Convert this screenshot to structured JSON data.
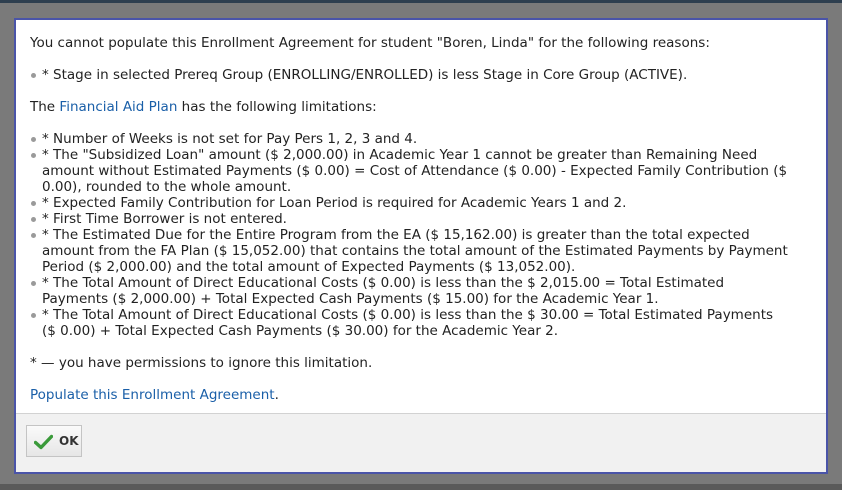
{
  "dialog": {
    "intro": "You cannot populate this Enrollment Agreement for student \"Boren, Linda\" for the following reasons:",
    "reasons": [
      "* Stage in selected Prereq Group (ENROLLING/ENROLLED) is less Stage in Core Group (ACTIVE)."
    ],
    "fa_prefix": "The ",
    "fa_link": "Financial Aid Plan",
    "fa_suffix": " has the following limitations:",
    "limitations": [
      [
        "* Number of Weeks is not set for Pay Pers 1, 2, 3 and 4."
      ],
      [
        "* The \"Subsidized Loan\" amount ($ 2,000.00) in Academic Year 1 cannot be greater than Remaining Need",
        "amount without Estimated Payments ($ 0.00) = Cost of Attendance ($ 0.00) - Expected Family Contribution ($",
        "0.00), rounded to the whole amount."
      ],
      [
        "* Expected Family Contribution for Loan Period is required for Academic Years 1 and 2."
      ],
      [
        "* First Time Borrower is not entered."
      ],
      [
        "* The Estimated Due for the Entire Program from the EA ($ 15,162.00) is greater than the total expected",
        "amount from the FA Plan ($ 15,052.00) that contains the total amount of the Estimated Payments by Payment",
        "Period ($ 2,000.00) and the total amount of Expected Payments ($ 13,052.00)."
      ],
      [
        "* The Total Amount of Direct Educational Costs ($ 0.00) is less than the $ 2,015.00 = Total Estimated",
        "Payments ($ 2,000.00) + Total Expected Cash Payments ($ 15.00) for the Academic Year 1."
      ],
      [
        "* The Total Amount of Direct Educational Costs ($ 0.00) is less than the $ 30.00 = Total Estimated Payments",
        "($ 0.00) + Total Expected Cash Payments ($ 30.00) for the Academic Year 2."
      ]
    ],
    "note": "* — you have permissions to ignore this limitation.",
    "populate_link": "Populate this Enrollment Agreement",
    "populate_suffix": ".",
    "ok_label": "OK"
  },
  "colors": {
    "dialog_border": "#4a54a8",
    "link": "#1a5fa8",
    "check_icon": "#3a9a3a"
  },
  "icons": {
    "ok": "checkmark-icon"
  }
}
